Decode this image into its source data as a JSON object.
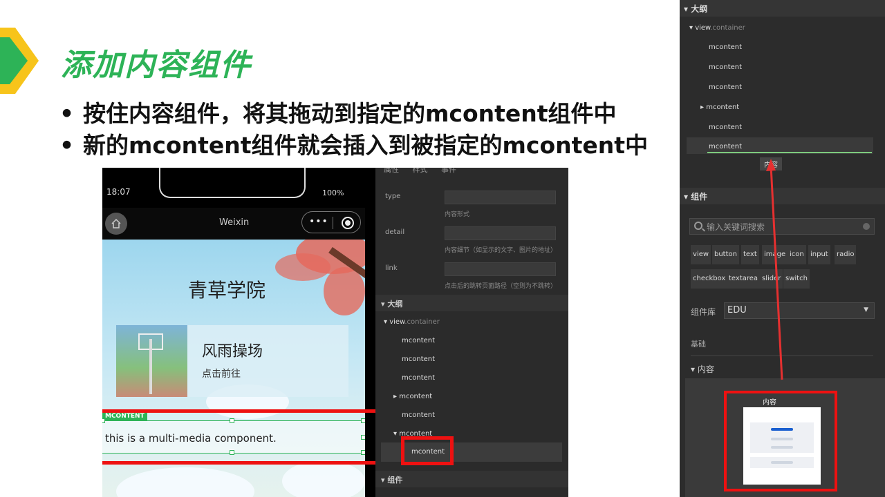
{
  "slide": {
    "title": "添加内容组件",
    "bullets": [
      "按住内容组件，将其拖动到指定的mcontent组件中",
      "新的mcontent组件就会插入到被指定的mcontent中"
    ]
  },
  "phone": {
    "time": "18:07",
    "battery": "100%",
    "nav_title": "Weixin",
    "capsule_dots": "•••",
    "school_name": "青草学院",
    "card": {
      "title": "风雨操场",
      "subtitle": "点击前往"
    },
    "mcontent_tag": "MCONTENT",
    "mcontent_text": "this is a multi-media component."
  },
  "properties_panel": {
    "tabs": [
      "属性",
      "样式",
      "事件"
    ],
    "fields": [
      {
        "label": "type",
        "hint": "内容形式"
      },
      {
        "label": "detail",
        "hint": "内容细节（如显示的文字、图片的地址）"
      },
      {
        "label": "link",
        "hint": "点击后的跳转页面路径（空则为不跳转）"
      }
    ],
    "outline_header": "大纲",
    "outline": {
      "root_label": "view",
      "root_class": ".container",
      "items": [
        "mcontent",
        "mcontent",
        "mcontent",
        "mcontent",
        "mcontent",
        "mcontent",
        "mcontent"
      ]
    },
    "components_header": "组件"
  },
  "right_panel": {
    "outline_header": "大纲",
    "root_label": "view",
    "root_class": ".container",
    "items": [
      "mcontent",
      "mcontent",
      "mcontent",
      "mcontent",
      "mcontent",
      "mcontent"
    ],
    "drag_label": "内容",
    "components_header": "组件",
    "search_placeholder": "输入关键词搜索",
    "chips": [
      "view",
      "button",
      "text",
      "image",
      "icon",
      "input",
      "radio",
      "checkbox",
      "textarea",
      "slider",
      "switch"
    ],
    "library_label": "组件库",
    "library_value": "EDU",
    "basic_label": "基础",
    "content_section": "内容",
    "content_card_label": "内容"
  },
  "colors": {
    "title_green": "#2db357",
    "highlight_red": "#e11111",
    "panel_dark": "#2b2b2b"
  }
}
